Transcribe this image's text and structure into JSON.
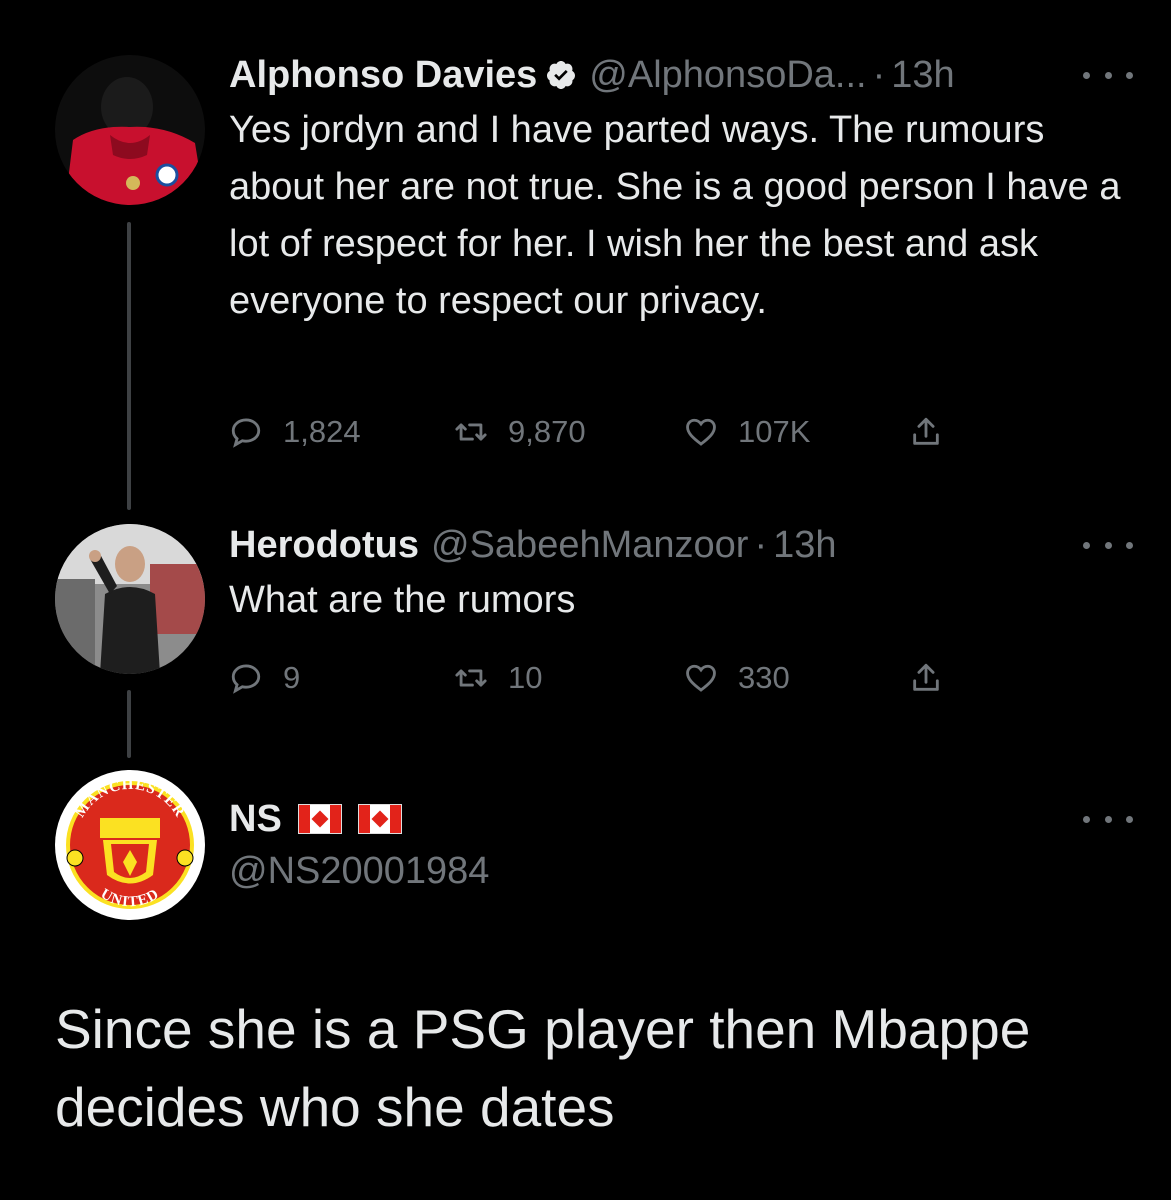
{
  "tweets": [
    {
      "name": "Alphonso Davies",
      "handle": "@AlphonsoDa...",
      "time": "13h",
      "text": "Yes jordyn and I have parted ways. The rumours about her are not true. She is a good person I have a lot of respect for her. I wish her the best and ask everyone to respect our privacy.",
      "replies": "1,824",
      "retweets": "9,870",
      "likes": "107K"
    },
    {
      "name": "Herodotus",
      "handle": "@SabeehManzoor",
      "time": "13h",
      "text": "What are the rumors",
      "replies": "9",
      "retweets": "10",
      "likes": "330"
    }
  ],
  "reply": {
    "name": "NS",
    "handle": "@NS20001984",
    "text": "Since she is a PSG player then Mbappe decides who she dates",
    "avatar_text_top": "MANCHESTER",
    "avatar_text_bottom": "UNITED"
  },
  "colors": {
    "background": "#000000",
    "text": "#e7e9ea",
    "muted": "#71767b",
    "thread_line": "#3e4144"
  }
}
